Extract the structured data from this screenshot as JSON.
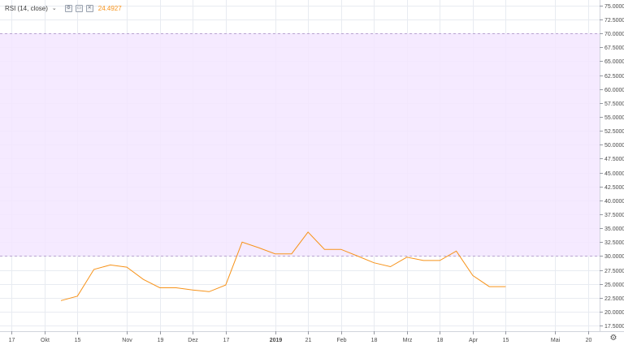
{
  "legend": {
    "label": "RSI (14, close)",
    "value": "24.4927",
    "value_color": "#f7931a"
  },
  "colors": {
    "line": "#f7931a",
    "band_fill": "#f3e6ff",
    "band_border": "#b9a4d1",
    "grid": "#e8ebf1",
    "axis_text": "#4a4a4a"
  },
  "chart_data": {
    "type": "line",
    "y_ticks": [
      "75.0000",
      "72.5000",
      "70.0000",
      "67.5000",
      "65.0000",
      "62.5000",
      "60.0000",
      "57.5000",
      "55.0000",
      "52.5000",
      "50.0000",
      "47.5000",
      "45.0000",
      "42.5000",
      "40.0000",
      "37.5000",
      "35.0000",
      "32.5000",
      "30.0000",
      "27.5000",
      "25.0000",
      "22.5000",
      "20.0000",
      "17.5000"
    ],
    "ylim": [
      16.5,
      76
    ],
    "band": [
      30,
      70
    ],
    "x_ticks": [
      {
        "label": "17",
        "x": 0
      },
      {
        "label": "Okt",
        "x": 10
      },
      {
        "label": "15",
        "x": 20
      },
      {
        "label": "Nov",
        "x": 35
      },
      {
        "label": "19",
        "x": 45
      },
      {
        "label": "Dez",
        "x": 55
      },
      {
        "label": "17",
        "x": 65
      },
      {
        "label": "2019",
        "x": 80,
        "bold": true
      },
      {
        "label": "21",
        "x": 90
      },
      {
        "label": "Feb",
        "x": 100
      },
      {
        "label": "18",
        "x": 110
      },
      {
        "label": "Mrz",
        "x": 120
      },
      {
        "label": "18",
        "x": 130
      },
      {
        "label": "Apr",
        "x": 140
      },
      {
        "label": "15",
        "x": 150
      },
      {
        "label": "Mai",
        "x": 165
      },
      {
        "label": "20",
        "x": 175
      }
    ],
    "xlim": [
      -3.5,
      178.5
    ],
    "x": [
      15,
      20,
      25,
      30,
      35,
      40,
      45,
      50,
      55,
      60,
      65,
      70,
      75,
      80,
      85,
      90,
      95,
      100,
      105,
      110,
      115,
      120,
      125,
      130,
      135,
      140,
      145,
      150
    ],
    "values": [
      22.0,
      22.8,
      27.6,
      28.4,
      28.0,
      25.8,
      24.3,
      24.3,
      23.9,
      23.6,
      24.8,
      32.5,
      31.5,
      30.4,
      30.4,
      34.3,
      31.2,
      31.2,
      30.0,
      28.8,
      28.1,
      29.8,
      29.2,
      29.2,
      30.9,
      26.5,
      24.5,
      24.5
    ],
    "gear_label": "⚙"
  }
}
